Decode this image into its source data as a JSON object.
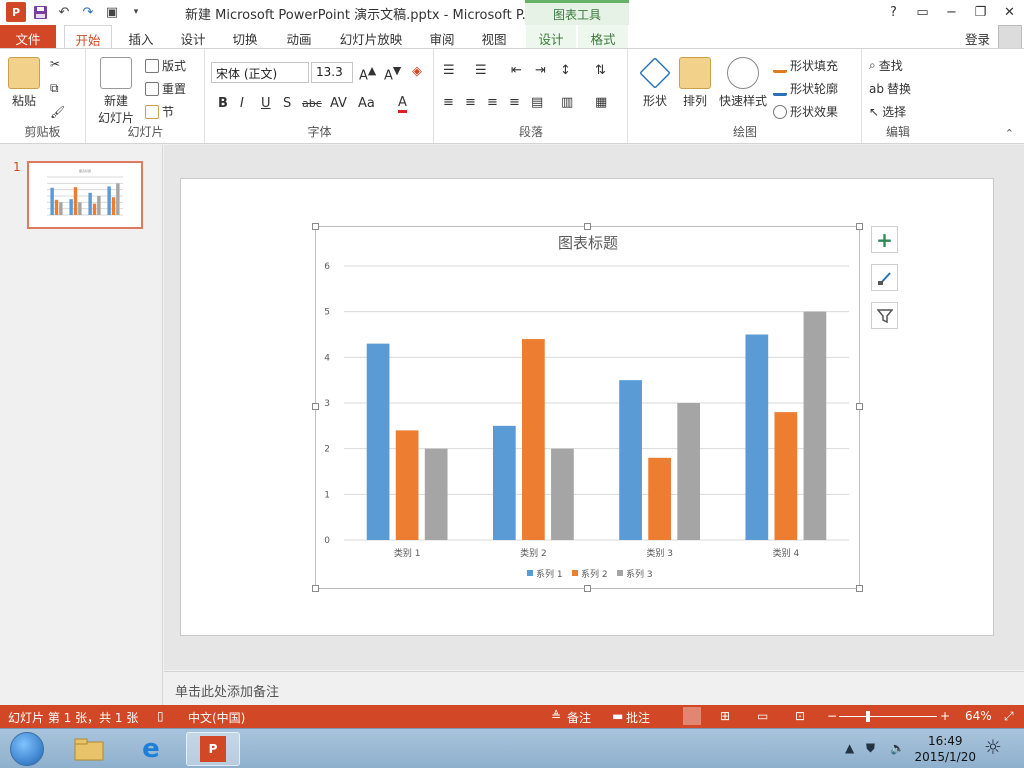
{
  "titlebar": {
    "title": "新建 Microsoft PowerPoint 演示文稿.pptx - Microsoft P...",
    "context_group": "图表工具",
    "help": "?",
    "minimize": "−",
    "restore": "❐",
    "close": "✕"
  },
  "tabs": {
    "file": "文件",
    "home": "开始",
    "insert": "插入",
    "design": "设计",
    "transitions": "切换",
    "animations": "动画",
    "slideshow": "幻灯片放映",
    "review": "审阅",
    "view": "视图",
    "chart_design": "设计",
    "chart_format": "格式",
    "signin": "登录"
  },
  "ribbon": {
    "clipboard": {
      "label": "剪贴板",
      "paste": "粘贴"
    },
    "slides": {
      "label": "幻灯片",
      "new_slide": "新建",
      "new_slide2": "幻灯片",
      "layout": "版式",
      "reset": "重置",
      "section": "节"
    },
    "font": {
      "label": "字体",
      "font_name": "宋体 (正文)",
      "font_size": "13.3"
    },
    "paragraph": {
      "label": "段落"
    },
    "drawing": {
      "label": "绘图",
      "shapes": "形状",
      "arrange": "排列",
      "quick_styles": "快速样式",
      "fill": "形状填充",
      "outline": "形状轮廓",
      "effects": "形状效果"
    },
    "editing": {
      "label": "编辑",
      "find": "查找",
      "replace": "替换",
      "select": "选择"
    }
  },
  "thumbnail": {
    "number": "1"
  },
  "notes_placeholder": "单击此处添加备注",
  "chart_data": {
    "type": "bar",
    "title": "图表标题",
    "categories": [
      "类别 1",
      "类别 2",
      "类别 3",
      "类别 4"
    ],
    "series": [
      {
        "name": "系列 1",
        "values": [
          4.3,
          2.5,
          3.5,
          4.5
        ],
        "color": "#5b9bd5"
      },
      {
        "name": "系列 2",
        "values": [
          2.4,
          4.4,
          1.8,
          2.8
        ],
        "color": "#ed7d31"
      },
      {
        "name": "系列 3",
        "values": [
          2,
          2,
          3,
          5
        ],
        "color": "#a5a5a5"
      }
    ],
    "ylim": [
      0,
      6
    ],
    "yticks": [
      "0",
      "1",
      "2",
      "3",
      "4",
      "5",
      "6"
    ],
    "grid": true,
    "legend": "bottom"
  },
  "statusbar": {
    "slide_info": "幻灯片 第 1 张，共 1 张",
    "language": "中文(中国)",
    "notes": "备注",
    "comments": "批注",
    "zoom": "64%"
  },
  "taskbar": {
    "time": "16:49",
    "date": "2015/1/20"
  }
}
